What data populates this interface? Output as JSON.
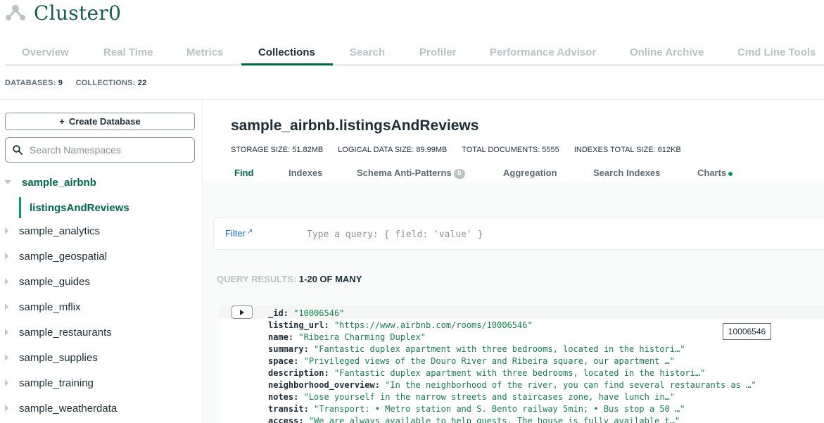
{
  "header": {
    "title": "Cluster0",
    "icon": "cluster-icon"
  },
  "top_tabs": [
    {
      "label": "Overview",
      "active": false
    },
    {
      "label": "Real Time",
      "active": false
    },
    {
      "label": "Metrics",
      "active": false
    },
    {
      "label": "Collections",
      "active": true
    },
    {
      "label": "Search",
      "active": false
    },
    {
      "label": "Profiler",
      "active": false
    },
    {
      "label": "Performance Advisor",
      "active": false
    },
    {
      "label": "Online Archive",
      "active": false
    },
    {
      "label": "Cmd Line Tools",
      "active": false
    }
  ],
  "counts": {
    "databases_label": "DATABASES:",
    "databases_value": "9",
    "collections_label": "COLLECTIONS:",
    "collections_value": "22"
  },
  "sidebar": {
    "create_db_label": "Create Database",
    "create_db_icon": "+",
    "search_placeholder": "Search Namespaces",
    "databases": [
      {
        "name": "sample_airbnb",
        "expanded": true,
        "collections": [
          "listingsAndReviews"
        ]
      },
      {
        "name": "sample_analytics"
      },
      {
        "name": "sample_geospatial"
      },
      {
        "name": "sample_guides"
      },
      {
        "name": "sample_mflix"
      },
      {
        "name": "sample_restaurants"
      },
      {
        "name": "sample_supplies"
      },
      {
        "name": "sample_training"
      },
      {
        "name": "sample_weatherdata"
      }
    ]
  },
  "collection": {
    "title": "sample_airbnb.listingsAndReviews",
    "stats": {
      "storage": "STORAGE SIZE: 51.82MB",
      "logical": "LOGICAL DATA SIZE: 89.99MB",
      "documents": "TOTAL DOCUMENTS: 5555",
      "indexes": "INDEXES TOTAL SIZE: 612KB"
    },
    "tabs": {
      "find": "Find",
      "indexes": "Indexes",
      "schema": "Schema Anti-Patterns",
      "schema_badge": "0",
      "aggregation": "Aggregation",
      "search_indexes": "Search Indexes",
      "charts": "Charts"
    }
  },
  "filter": {
    "label": "Filter",
    "placeholder": "Type a query: { field: 'value' }"
  },
  "query_results": {
    "label": "QUERY RESULTS:",
    "range": "1-20 OF MANY"
  },
  "document": {
    "fields": [
      {
        "key": "_id:",
        "value": "\"10006546\""
      },
      {
        "key": "listing_url:",
        "value": "\"https://www.airbnb.com/rooms/10006546\""
      },
      {
        "key": "name:",
        "value": "\"Ribeira Charming Duplex\""
      },
      {
        "key": "summary:",
        "value": "\"Fantastic duplex apartment with three bedrooms, located in the histori…\""
      },
      {
        "key": "space:",
        "value": "\"Privileged views of the Douro River and Ribeira square, our apartment …\""
      },
      {
        "key": "description:",
        "value": "\"Fantastic duplex apartment with three bedrooms, located in the histori…\""
      },
      {
        "key": "neighborhood_overview:",
        "value": "\"In the neighborhood of the river, you can find several restaurants as …\""
      },
      {
        "key": "notes:",
        "value": "\"Lose yourself in the narrow streets and staircases zone, have lunch in…\""
      },
      {
        "key": "transit:",
        "value": "\"Transport: • Metro station and S. Bento railway 5min; • Bus stop a 50 …\""
      },
      {
        "key": "access:",
        "value": "\"We are always available to help guests. The house is fully available t…\""
      }
    ],
    "tooltip": "10006546"
  },
  "colors": {
    "brand": "#00684a",
    "accent": "#00a35c",
    "link": "#016bf8"
  }
}
